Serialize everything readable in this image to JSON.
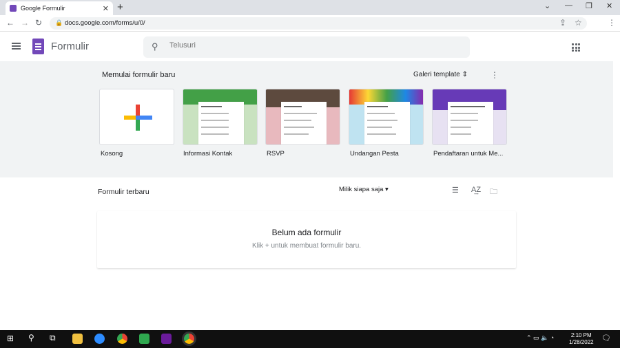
{
  "browser": {
    "tab_title": "Google Formulir",
    "url": "docs.google.com/forms/u/0/"
  },
  "app": {
    "title": "Formulir",
    "search_placeholder": "Telusuri"
  },
  "templates": {
    "heading": "Memulai formulir baru",
    "gallery_label": "Galeri template",
    "items": [
      {
        "label": "Kosong"
      },
      {
        "label": "Informasi Kontak"
      },
      {
        "label": "RSVP"
      },
      {
        "label": "Undangan Pesta"
      },
      {
        "label": "Pendaftaran untuk Me..."
      }
    ]
  },
  "recent": {
    "title": "Formulir terbaru",
    "owner_filter": "Milik siapa saja",
    "empty_title": "Belum ada formulir",
    "empty_hint": "Klik + untuk membuat formulir baru."
  },
  "taskbar": {
    "time": "2:10 PM",
    "date": "1/28/2022"
  },
  "colors": {
    "forms_purple": "#7248b9",
    "template_bg": "#f1f3f4"
  }
}
